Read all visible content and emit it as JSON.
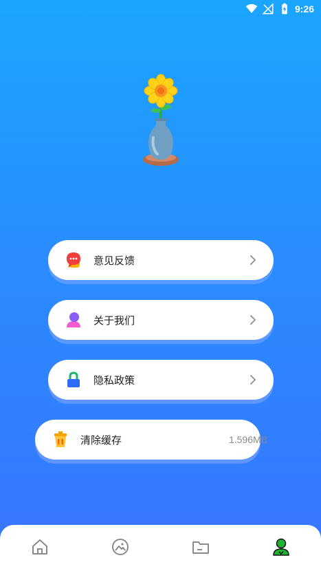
{
  "status_bar": {
    "time": "9:26",
    "icons": [
      "wifi-icon",
      "signal-off-icon",
      "battery-charging-icon"
    ]
  },
  "hero": {
    "image": "flower-vase-illustration"
  },
  "menu": [
    {
      "label": "意见反馈",
      "icon": "feedback-chat-icon",
      "chevron": "chevron-right-icon"
    },
    {
      "label": "关于我们",
      "icon": "person-icon",
      "chevron": "chevron-right-icon"
    },
    {
      "label": "隐私政策",
      "icon": "lock-icon",
      "chevron": "chevron-right-icon"
    },
    {
      "label": "清除缓存",
      "icon": "trash-icon",
      "value": "1.596MB"
    }
  ],
  "bottom_nav": {
    "tabs": [
      {
        "icon": "home-icon",
        "active": false
      },
      {
        "icon": "image-icon",
        "active": false
      },
      {
        "icon": "folder-icon",
        "active": false
      },
      {
        "icon": "profile-icon",
        "active": true
      }
    ]
  },
  "colors": {
    "background_top": "#1aa6ff",
    "background_bottom": "#3a74ff",
    "active_tab": "#1fb233",
    "inactive_tab": "#8a8a8a"
  }
}
